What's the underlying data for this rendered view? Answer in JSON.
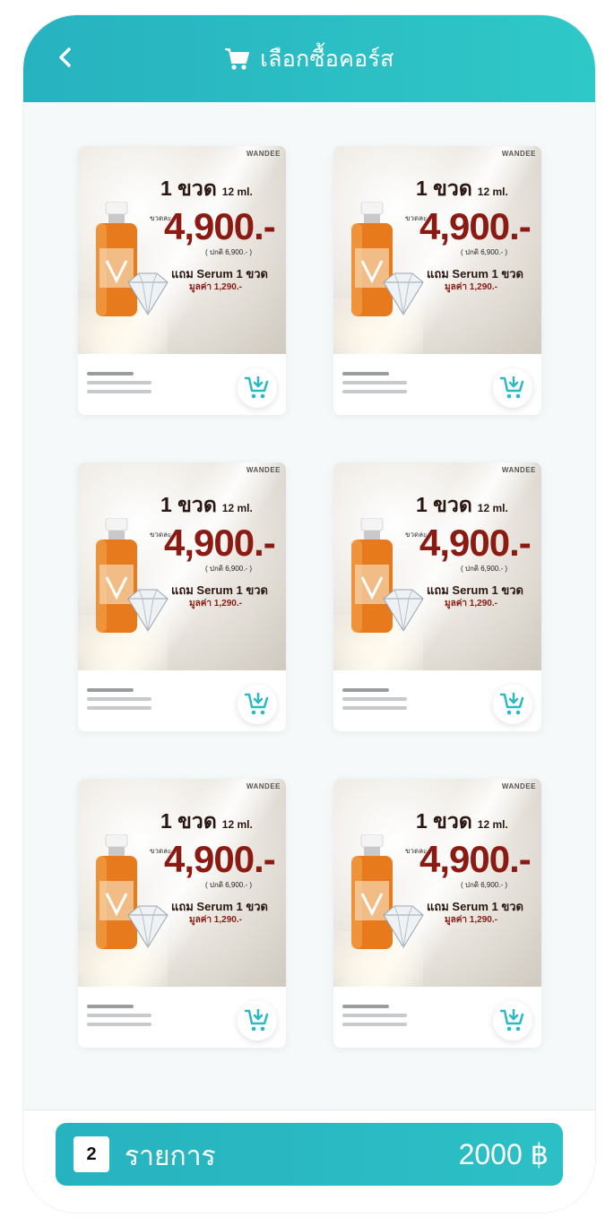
{
  "header": {
    "title": "เลือกซื้อคอร์ส",
    "back_icon": "chevron-left-icon",
    "title_icon": "cart-icon"
  },
  "colors": {
    "primary": "#2cbcc4",
    "price_red": "#8a1a12"
  },
  "products": [
    {
      "brand": "WANDEE",
      "headline": "1 ขวด",
      "volume": "12 ml.",
      "each_label": "ขวดละ",
      "price": "4,900.-",
      "normal_price": "( ปกติ 6,900.- )",
      "gift": "แถม Serum 1 ขวด",
      "gift_value": "มูลค่า 1,290.-",
      "add_icon": "add-to-cart-icon"
    },
    {
      "brand": "WANDEE",
      "headline": "1 ขวด",
      "volume": "12 ml.",
      "each_label": "ขวดละ",
      "price": "4,900.-",
      "normal_price": "( ปกติ 6,900.- )",
      "gift": "แถม Serum 1 ขวด",
      "gift_value": "มูลค่า 1,290.-",
      "add_icon": "add-to-cart-icon"
    },
    {
      "brand": "WANDEE",
      "headline": "1 ขวด",
      "volume": "12 ml.",
      "each_label": "ขวดละ",
      "price": "4,900.-",
      "normal_price": "( ปกติ 6,900.- )",
      "gift": "แถม Serum 1 ขวด",
      "gift_value": "มูลค่า 1,290.-",
      "add_icon": "add-to-cart-icon"
    },
    {
      "brand": "WANDEE",
      "headline": "1 ขวด",
      "volume": "12 ml.",
      "each_label": "ขวดละ",
      "price": "4,900.-",
      "normal_price": "( ปกติ 6,900.- )",
      "gift": "แถม Serum 1 ขวด",
      "gift_value": "มูลค่า 1,290.-",
      "add_icon": "add-to-cart-icon"
    },
    {
      "brand": "WANDEE",
      "headline": "1 ขวด",
      "volume": "12 ml.",
      "each_label": "ขวดละ",
      "price": "4,900.-",
      "normal_price": "( ปกติ 6,900.- )",
      "gift": "แถม Serum 1 ขวด",
      "gift_value": "มูลค่า 1,290.-",
      "add_icon": "add-to-cart-icon"
    },
    {
      "brand": "WANDEE",
      "headline": "1 ขวด",
      "volume": "12 ml.",
      "each_label": "ขวดละ",
      "price": "4,900.-",
      "normal_price": "( ปกติ 6,900.- )",
      "gift": "แถม Serum 1 ขวด",
      "gift_value": "มูลค่า 1,290.-",
      "add_icon": "add-to-cart-icon"
    }
  ],
  "summary": {
    "count": "2",
    "label": "รายการ",
    "total": "2000 ฿"
  }
}
